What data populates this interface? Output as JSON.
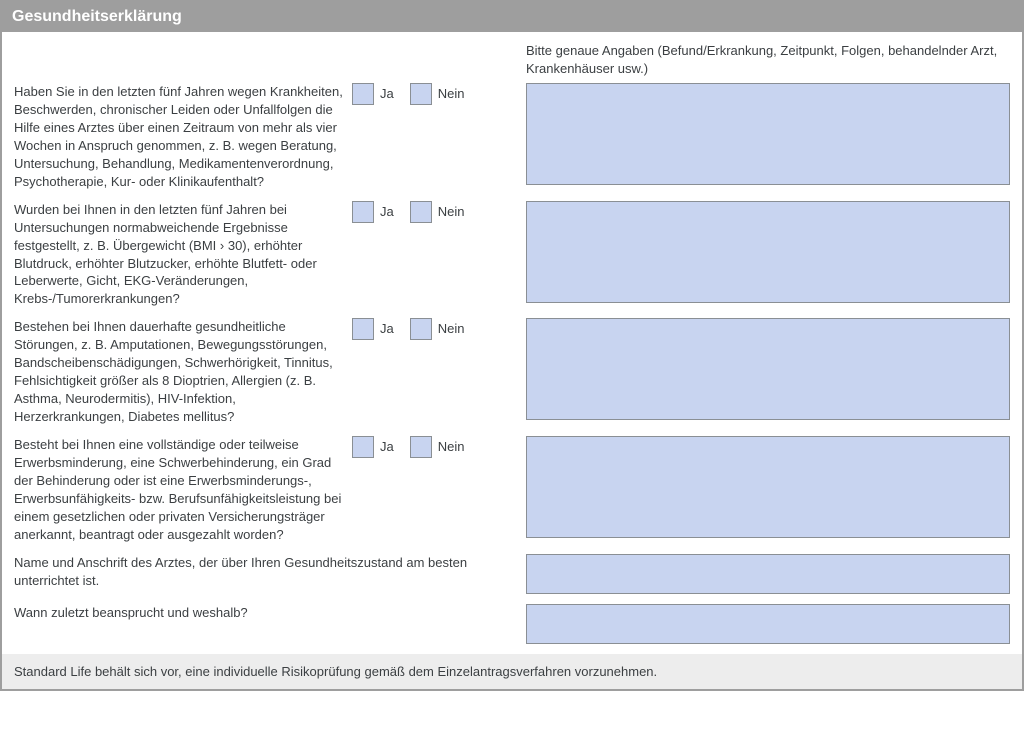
{
  "header": {
    "title": "Gesundheitserklärung"
  },
  "instruction": "Bitte genaue Angaben (Befund/Erkrankung, Zeitpunkt, Folgen, behandelnder Arzt, Krankenhäuser usw.)",
  "labels": {
    "yes": "Ja",
    "no": "Nein"
  },
  "questions": [
    {
      "text": "Haben Sie in den letzten fünf Jahren wegen Krankheiten, Beschwerden, chronischer Leiden oder Unfallfolgen die Hilfe eines Arztes über einen Zeitraum von mehr als vier Wochen in Anspruch genommen, z. B. wegen Beratung, Untersuchung, Behandlung, Medikamentenverordnung, Psychotherapie, Kur- oder Klinikaufenthalt?"
    },
    {
      "text": "Wurden bei Ihnen in den letzten fünf Jahren bei Untersuchungen normabweichende Ergebnisse festgestellt, z. B. Übergewicht (BMI › 30), erhöhter Blutdruck, erhöhter Blutzucker, erhöhte Blutfett- oder Leberwerte, Gicht, EKG-Veränderungen, Krebs-/Tumorerkrankungen?"
    },
    {
      "text": "Bestehen bei Ihnen dauerhafte gesundheitliche Störungen, z. B. Amputationen, Bewegungsstörungen, Bandscheibenschädigungen, Schwerhörigkeit, Tinnitus, Fehlsichtigkeit größer als 8 Dioptrien, Allergien (z. B. Asthma, Neurodermitis), HIV-Infektion, Herzerkrankungen, Diabetes mellitus?"
    },
    {
      "text": "Besteht bei Ihnen eine vollständige oder teilweise Erwerbsminderung, eine Schwerbehinderung, ein Grad der Behinderung oder ist eine Erwerbsminderungs-, Erwerbsunfähigkeits- bzw. Berufsunfähigkeitsleistung bei einem gesetzlichen oder privaten Versicherungsträger anerkannt, beantragt oder ausgezahlt worden?"
    }
  ],
  "doctor": {
    "line1": "Name und Anschrift des Arztes, der über Ihren Gesundheitszustand am besten unterrichtet ist.",
    "line2": "Wann zuletzt beansprucht und weshalb?"
  },
  "footer": "Standard Life behält sich vor, eine individuelle Risikoprüfung gemäß dem Einzelantragsverfahren vorzunehmen."
}
